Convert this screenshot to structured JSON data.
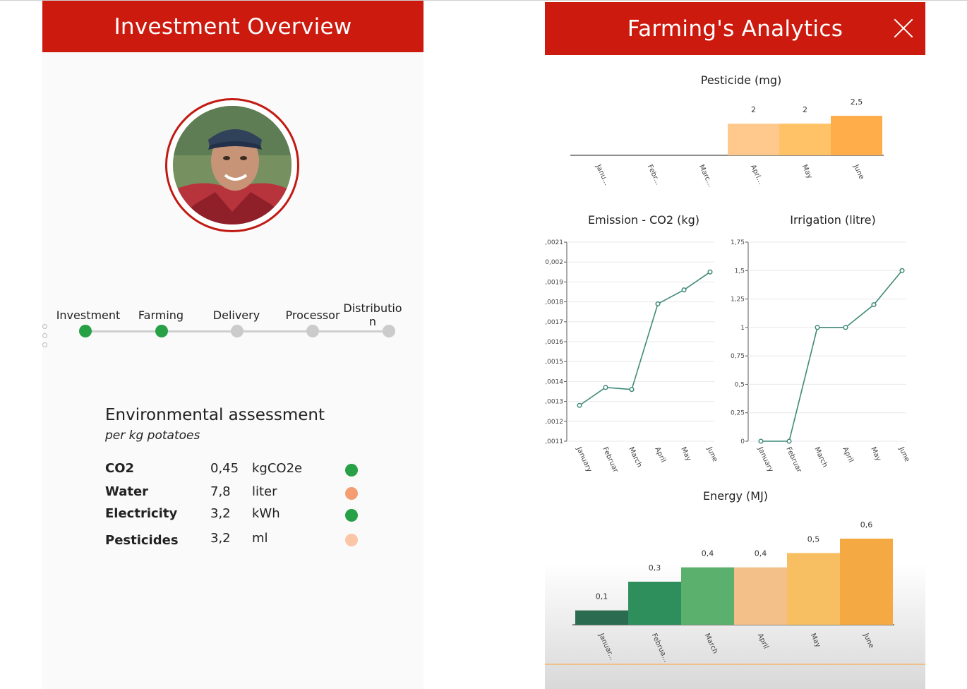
{
  "left": {
    "title": "Investment Overview",
    "steps": [
      {
        "label": "Investment",
        "done": true
      },
      {
        "label": "Farming",
        "done": true
      },
      {
        "label": "Delivery",
        "done": false
      },
      {
        "label": "Processor",
        "done": false
      },
      {
        "label": "Distributio\nn",
        "done": false
      }
    ],
    "env": {
      "title": "Environmental assessment",
      "subtitle": "per kg potatoes",
      "rows": [
        {
          "name": "CO2",
          "value": "0,45",
          "unit": "kgCO2e",
          "status_color": "#27a046"
        },
        {
          "name": "Water",
          "value": "7,8",
          "unit": "liter",
          "status_color": "#f59d72"
        },
        {
          "name": "Electricity",
          "value": "3,2",
          "unit": "kWh",
          "status_color": "#27a046"
        },
        {
          "name": "Pesticides",
          "value": "3,2",
          "unit": "ml",
          "status_color": "#fbc6a8"
        }
      ]
    }
  },
  "right": {
    "title": "Farming's Analytics"
  },
  "colors": {
    "header": "#cc1a0e",
    "line": "#3f8a78"
  },
  "chart_data": [
    {
      "type": "bar",
      "title": "Pesticide (mg)",
      "categories": [
        "Janu...",
        "Febr...",
        "Marc...",
        "Apri...",
        "May",
        "June"
      ],
      "values": [
        0,
        0,
        0,
        2,
        2,
        2.5
      ],
      "value_labels": [
        "",
        "",
        "",
        "2",
        "2",
        "2,5"
      ],
      "colors": [
        "#ffd0a0",
        "#ffd0a0",
        "#ffd0a0",
        "#ffc98e",
        "#ffc266",
        "#ffad4a"
      ]
    },
    {
      "type": "line",
      "title": "Emission - CO2 (kg)",
      "x": [
        "January",
        "Februar",
        "March",
        "April",
        "May",
        "June"
      ],
      "y": [
        0.00128,
        0.00137,
        0.00136,
        0.00179,
        0.00186,
        0.00195
      ],
      "ylim": [
        0.0011,
        0.0021
      ],
      "yticks": [
        "0,0011",
        "0,0012",
        "0,0013",
        "0,0014",
        "0,0015",
        "0,0016",
        "0,0017",
        "0,0018",
        "0,0019",
        "0,002",
        "0,0021"
      ]
    },
    {
      "type": "line",
      "title": "Irrigation (litre)",
      "x": [
        "January",
        "Februar",
        "March",
        "April",
        "May",
        "June"
      ],
      "y": [
        0,
        0,
        1,
        1,
        1.2,
        1.5
      ],
      "ylim": [
        0,
        1.75
      ],
      "yticks": [
        "0",
        "0,25",
        "0,5",
        "0,75",
        "1",
        "1,25",
        "1,5",
        "1,75"
      ]
    },
    {
      "type": "bar",
      "title": "Energy (MJ)",
      "categories": [
        "Januar...",
        "Februa...",
        "March",
        "April",
        "May",
        "June"
      ],
      "values": [
        0.1,
        0.3,
        0.4,
        0.4,
        0.5,
        0.6
      ],
      "value_labels": [
        "0,1",
        "0,3",
        "0,4",
        "0,4",
        "0,5",
        "0,6"
      ],
      "colors": [
        "#2b6b4f",
        "#2e8f5c",
        "#5bb06d",
        "#f3c08a",
        "#f8bf62",
        "#f5a942"
      ]
    }
  ]
}
